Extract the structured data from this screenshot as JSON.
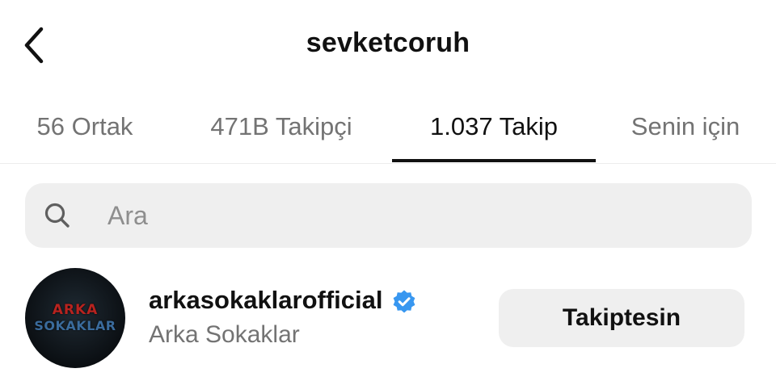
{
  "header": {
    "title": "sevketcoruh",
    "back_icon": "chevron-left-icon"
  },
  "tabs": [
    {
      "label": "56 Ortak",
      "active": false
    },
    {
      "label": "471B Takipçi",
      "active": false
    },
    {
      "label": "1.037 Takip",
      "active": true
    },
    {
      "label": "Senin için",
      "active": false
    }
  ],
  "search": {
    "placeholder": "Ara",
    "value": "",
    "icon": "search-icon"
  },
  "list": [
    {
      "username": "arkasokaklarofficial",
      "full_name": "Arka Sokaklar",
      "verified": true,
      "avatar_text": [
        "ARKA",
        "SOKAKLAR"
      ],
      "button_label": "Takiptesin"
    }
  ],
  "colors": {
    "text": "#111111",
    "secondary_text": "#737373",
    "search_bg": "#efefef",
    "button_bg": "#efefef",
    "verified_blue": "#3897f0",
    "avatar_red": "#b8231f",
    "avatar_blue": "#3a6b9c"
  }
}
